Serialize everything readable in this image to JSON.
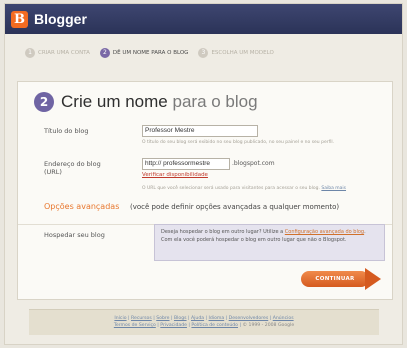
{
  "header": {
    "logo_letter": "B",
    "brand": "Blogger"
  },
  "steps": [
    {
      "num": "1",
      "label": "CRIAR UMA CONTA",
      "active": false
    },
    {
      "num": "2",
      "label": "DÊ UM NOME PARA O BLOG",
      "active": true
    },
    {
      "num": "3",
      "label": "ESCOLHA UM MODELO",
      "active": false
    }
  ],
  "main": {
    "step_number": "2",
    "heading_primary": "Crie um nome",
    "heading_secondary": "para o blog",
    "title_label": "Título do blog",
    "title_value": "Professor Mestre",
    "title_hint": "O título do seu blog será exibido no seu blog publicado, no seu painel e no seu perfil.",
    "address_label": "Endereço do blog (URL)",
    "address_value": "http:// professormestre",
    "address_suffix": ".blogspot.com",
    "check_availability": "Verificar disponibilidade",
    "address_hint": "O URL que você selecionar será usado para visitantes para acessar o seu blog.",
    "address_hint_link": "Saiba mais",
    "advanced_title": "Opções avançadas",
    "advanced_note": "(você pode definir opções avançadas a qualquer momento)",
    "host_label": "Hospedar seu blog",
    "host_text_1": "Deseja hospedar o blog em outro lugar? Utilize a ",
    "host_link": "Configuração avançada do blog",
    "host_text_2": ". Com ela você poderá hospedar o blog em outro lugar que não o Blogspot.",
    "continue_label": "CONTINUAR"
  },
  "footer": {
    "line1": [
      "Início",
      "Recursos",
      "Sobre",
      "Blogs",
      "Ajuda",
      "Idioma",
      "Desenvolvedores",
      "Anúncios"
    ],
    "line2": [
      "Termos de Serviço",
      "Privacidade",
      "Política de conteúdo"
    ],
    "copyright": "© 1999 - 2008 Google"
  }
}
